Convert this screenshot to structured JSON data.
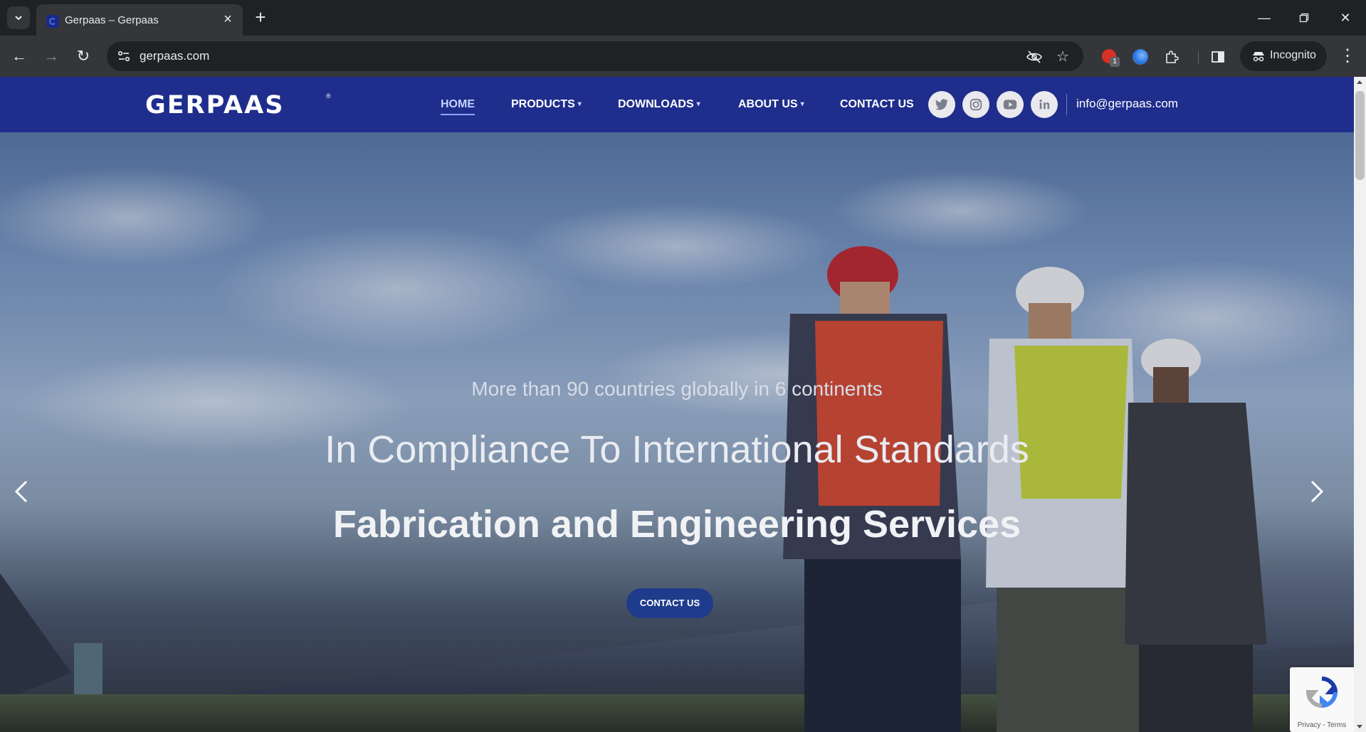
{
  "browser": {
    "tab_title": "Gerpaas – Gerpaas",
    "url": "gerpaas.com",
    "profile_label": "Incognito",
    "extension_badge": "1"
  },
  "site": {
    "logo": "GERPAAS",
    "logo_mark": "®",
    "nav": {
      "home": "HOME",
      "products": "PRODUCTS",
      "downloads": "DOWNLOADS",
      "about": "ABOUT US",
      "contact": "CONTACT US"
    },
    "email": "info@gerpaas.com",
    "social_icons": [
      "twitter-icon",
      "instagram-icon",
      "youtube-icon",
      "linkedin-icon"
    ]
  },
  "hero": {
    "line1": "More than 90 countries globally in 6 continents",
    "line2": "In Compliance To International Standards",
    "line3": "Fabrication and Engineering Services",
    "cta": "CONTACT US"
  },
  "recaptcha": {
    "links": "Privacy - Terms"
  },
  "colors": {
    "header_bg": "#1f2d8c",
    "cta_bg": "#1f3b8c",
    "chrome_dark": "#202124",
    "chrome_toolbar": "#35363a"
  }
}
